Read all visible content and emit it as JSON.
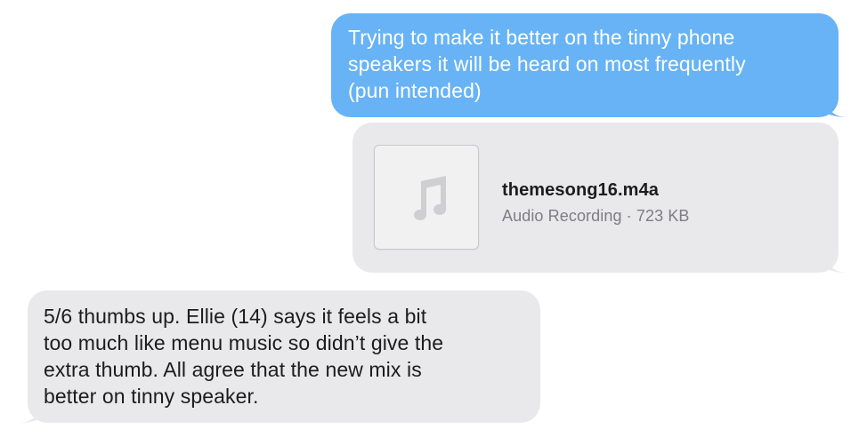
{
  "conversation": {
    "outgoing_message": {
      "lines": [
        "Trying to make it better on the tinny phone",
        "speakers it will be heard on most frequently",
        "(pun intended)"
      ],
      "bubble_color": "#67b3f5"
    },
    "attachment": {
      "icon": "music-note-icon",
      "file_name": "themesong16.m4a",
      "meta": "Audio Recording · 723 KB",
      "bubble_color": "#e9e9eb"
    },
    "incoming_message": {
      "lines": [
        "5/6 thumbs up. Ellie (14) says it feels a bit",
        "too much like menu music so didn’t give the",
        "extra thumb. All agree that the new mix is",
        "better on tinny speaker."
      ],
      "bubble_color": "#e9e9eb"
    }
  }
}
